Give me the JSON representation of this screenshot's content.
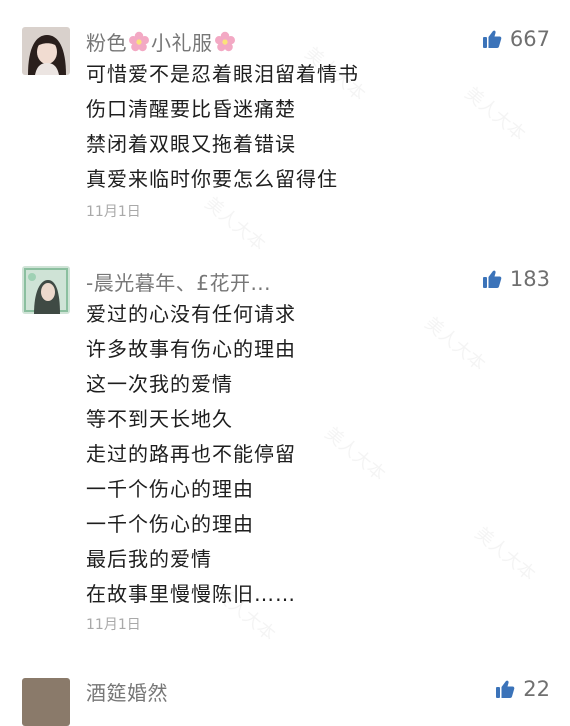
{
  "comments": [
    {
      "user": {
        "name_a": "粉色",
        "name_b": "小礼服"
      },
      "likes": "667",
      "lines": [
        "可惜爱不是忍着眼泪留着情书",
        "伤口清醒要比昏迷痛楚",
        "禁闭着双眼又拖着错误",
        "真爱来临时你要怎么留得住"
      ],
      "date": "11月1日"
    },
    {
      "user": {
        "name": "-晨光暮年、£花开..."
      },
      "likes": "183",
      "lines": [
        "爱过的心没有任何请求",
        "许多故事有伤心的理由",
        "这一次我的爱情",
        "等不到天长地久",
        "走过的路再也不能停留",
        "一千个伤心的理由",
        "一千个伤心的理由",
        "最后我的爱情",
        "在故事里慢慢陈旧……"
      ],
      "date": "11月1日"
    },
    {
      "user": {
        "name": "酒筵婚然"
      },
      "likes": "22"
    }
  ],
  "watermark_text": "美人大本",
  "colors": {
    "like_icon": "#3b73b9",
    "date": "#a9a9a9",
    "username": "#777777"
  }
}
